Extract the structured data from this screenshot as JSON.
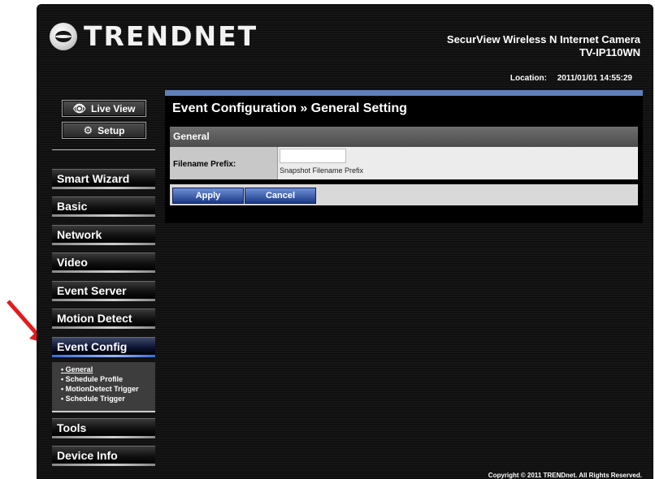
{
  "brand": {
    "logo_text": "TRENDNET"
  },
  "header": {
    "product_line1": "SecurView Wireless N Internet Camera",
    "product_line2": "TV-IP110WN",
    "location_label": "Location:",
    "location_value": "2011/01/01 14:55:29"
  },
  "top_buttons": {
    "live_view": "Live View",
    "setup": "Setup"
  },
  "nav": {
    "smart_wizard": "Smart Wizard",
    "basic": "Basic",
    "network": "Network",
    "video": "Video",
    "event_server": "Event Server",
    "motion_detect": "Motion Detect",
    "event_config": "Event Config",
    "tools": "Tools",
    "device_info": "Device Info"
  },
  "submenu": {
    "general": "General",
    "schedule_profile": "Schedule Profile",
    "motiondetect_trigger": "MotionDetect Trigger",
    "schedule_trigger": "Schedule Trigger"
  },
  "main": {
    "title": "Event Configuration » General Setting",
    "section": "General",
    "filename_label": "Filename Prefix:",
    "filename_value": "",
    "filename_hint": "Snapshot Filename Prefix",
    "apply": "Apply",
    "cancel": "Cancel"
  },
  "footer": {
    "copyright": "Copyright © 2011 TRENDnet. All Rights Reserved."
  },
  "colors": {
    "accent_blue": "#3b6bd8",
    "annotation_arrow": "#e41b1b"
  },
  "submenu_bullet": "•"
}
